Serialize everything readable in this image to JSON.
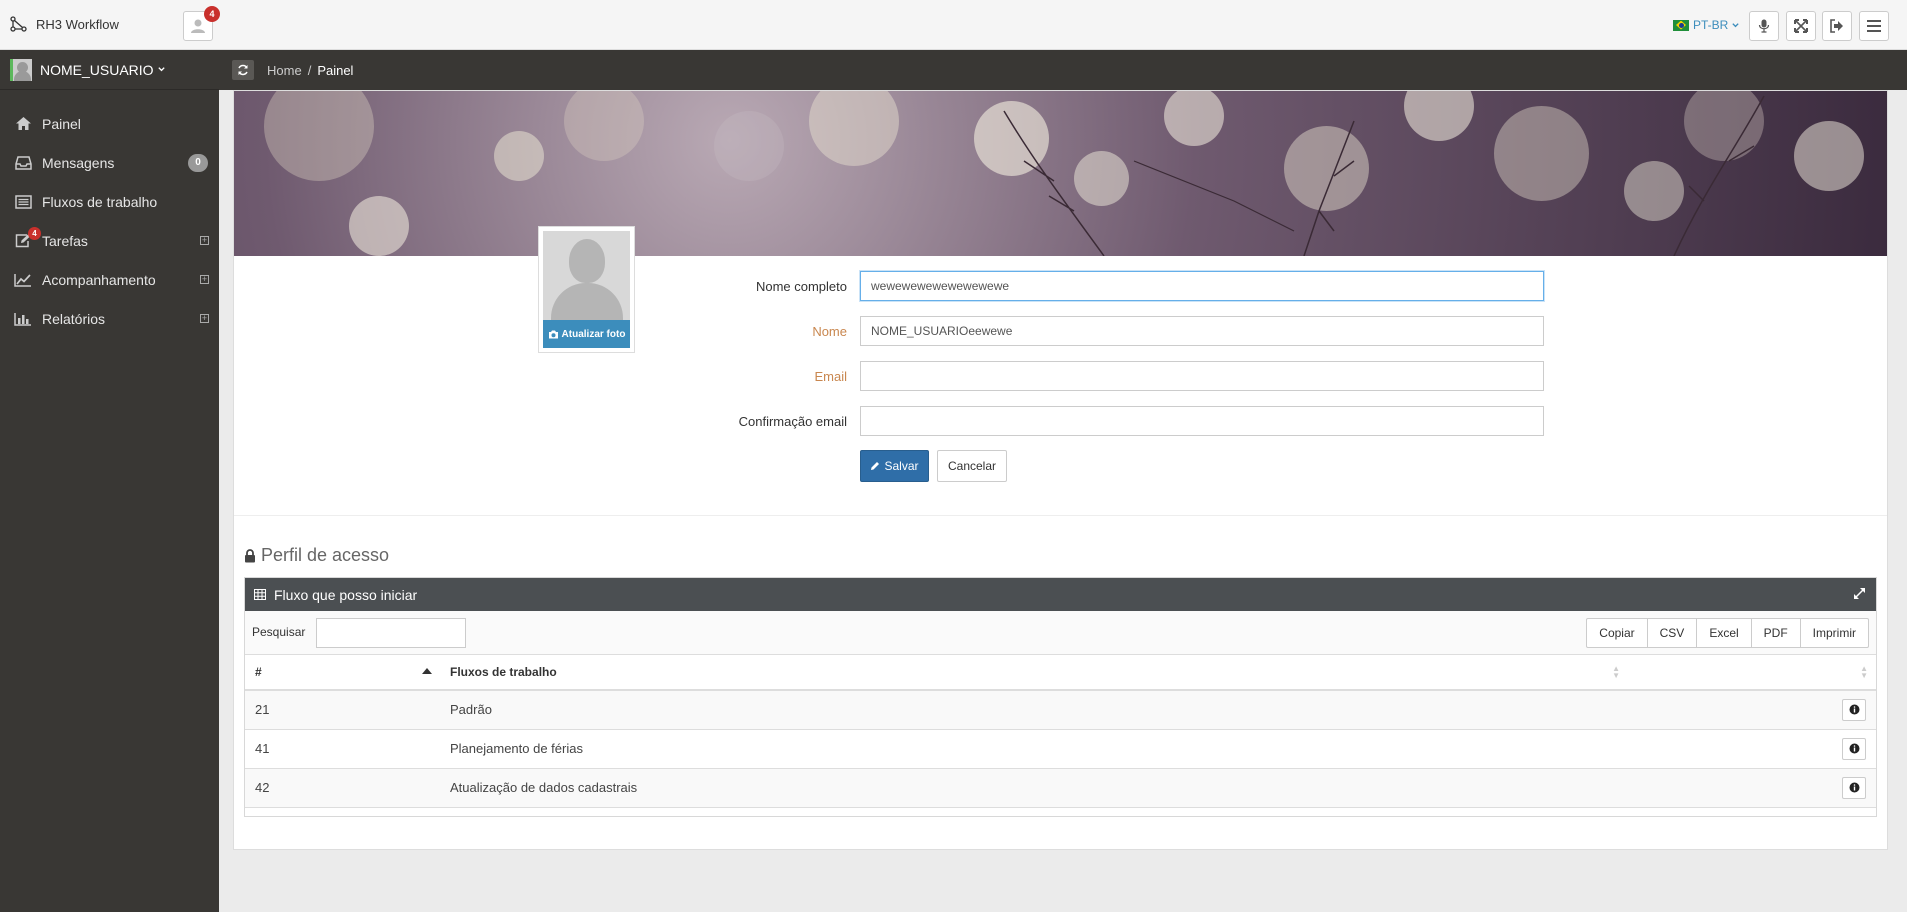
{
  "app": {
    "brand": "RH3 Workflow",
    "notifications_count": "4",
    "language": "PT-BR"
  },
  "sidebar": {
    "user_name": "NOME_USUARIO",
    "items": [
      {
        "label": "Painel",
        "icon": "home-icon"
      },
      {
        "label": "Mensagens",
        "icon": "inbox-icon",
        "count": "0"
      },
      {
        "label": "Fluxos de trabalho",
        "icon": "list-icon"
      },
      {
        "label": "Tarefas",
        "icon": "edit-icon",
        "badge": "4"
      },
      {
        "label": "Acompanhamento",
        "icon": "line-chart-icon"
      },
      {
        "label": "Relatórios",
        "icon": "bar-chart-icon"
      }
    ]
  },
  "breadcrumb": {
    "home": "Home",
    "separator": "/",
    "current": "Painel"
  },
  "profile": {
    "update_photo_label": "Atualizar foto",
    "fields": {
      "full_name_label": "Nome completo",
      "full_name_value": "wewewewewewewewewe",
      "name_label": "Nome",
      "name_value": "NOME_USUARIOeewewe",
      "email_label": "Email",
      "email_value": "",
      "email_confirm_label": "Confirmação email",
      "email_confirm_value": ""
    },
    "save_label": "Salvar",
    "cancel_label": "Cancelar"
  },
  "access": {
    "section_title": "Perfil de acesso",
    "panel_title": "Fluxo que posso iniciar",
    "search_label": "Pesquisar",
    "search_value": "",
    "export_buttons": [
      "Copiar",
      "CSV",
      "Excel",
      "PDF",
      "Imprimir"
    ],
    "columns": [
      "#",
      "Fluxos de trabalho",
      ""
    ],
    "rows": [
      {
        "id": "21",
        "name": "Padrão"
      },
      {
        "id": "41",
        "name": "Planejamento de férias"
      },
      {
        "id": "42",
        "name": "Atualização de dados cadastrais"
      }
    ]
  },
  "colors": {
    "sidebar_bg": "#393734",
    "primary": "#2f6ea8",
    "accent_blue": "#3c8dbc",
    "badge_red": "#c9302c",
    "label_warning": "#c9874f",
    "panel_header": "#4b4f52"
  }
}
